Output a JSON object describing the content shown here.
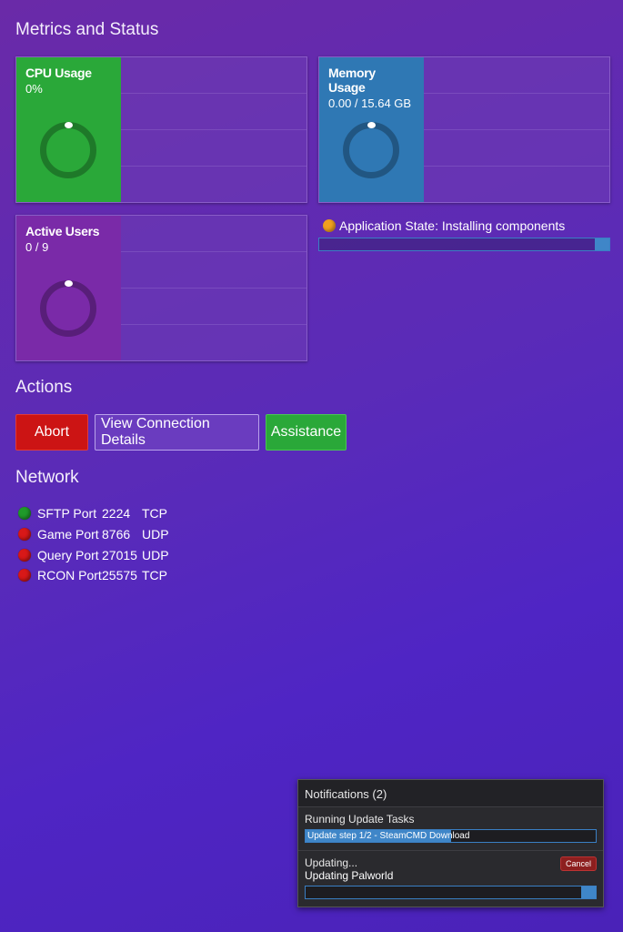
{
  "sections": {
    "metrics_title": "Metrics and Status",
    "actions_title": "Actions",
    "network_title": "Network"
  },
  "metrics": {
    "cpu": {
      "title": "CPU Usage",
      "value": "0%",
      "color": "#2aa839"
    },
    "memory": {
      "title": "Memory Usage",
      "value": "0.00 / 15.64 GB",
      "color": "#2f78b4"
    },
    "users": {
      "title": "Active Users",
      "value": "0 / 9",
      "color": "#7a2aa8"
    }
  },
  "app_state": {
    "label": "Application State: Installing components",
    "indicator_color": "#f0a020",
    "progress": 0.95
  },
  "actions": {
    "abort_label": "Abort",
    "connection_label": "View Connection Details",
    "assistance_label": "Assistance",
    "abort_color": "#cc1414",
    "assistance_color": "#2aa839"
  },
  "network": {
    "ports": [
      {
        "name": "SFTP Port",
        "port": "2224",
        "protocol": "TCP",
        "status": "green"
      },
      {
        "name": "Game Port",
        "port": "8766",
        "protocol": "UDP",
        "status": "red"
      },
      {
        "name": "Query Port",
        "port": "27015",
        "protocol": "UDP",
        "status": "red"
      },
      {
        "name": "RCON Port",
        "port": "25575",
        "protocol": "TCP",
        "status": "red"
      }
    ]
  },
  "notifications": {
    "header": "Notifications (2)",
    "task1": {
      "title": "Running Update Tasks",
      "bar_label": "Update step 1/2 - SteamCMD Download",
      "progress": 0.5
    },
    "task2": {
      "title": "Updating...",
      "subtitle": "Updating Palworld",
      "cancel_label": "Cancel",
      "progress": 0.95
    }
  }
}
